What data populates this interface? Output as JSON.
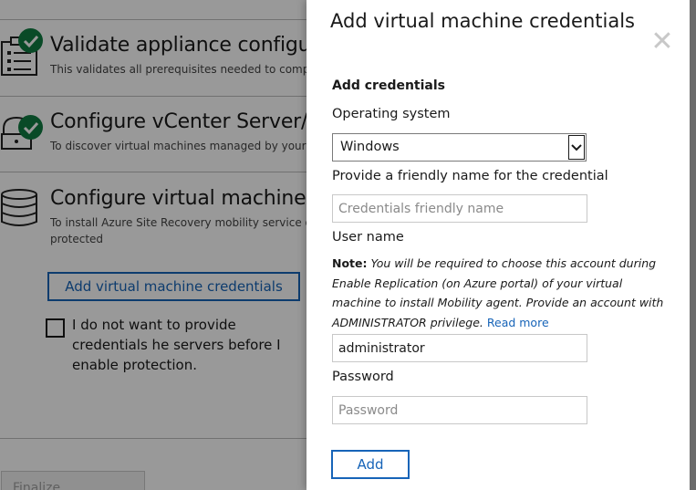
{
  "background": {
    "steps": [
      {
        "title": "Validate appliance configura",
        "description": "This validates all prerequisites needed to complet"
      },
      {
        "title": "Configure vCenter Server/vS",
        "description": "To discover virtual machines managed by your vC"
      },
      {
        "title": "Configure virtual machine cr",
        "description": "To install Azure Site Recovery mobility service on",
        "description_line2": "protected"
      }
    ],
    "add_vm_credentials_button": "Add virtual machine credentials",
    "checkbox_label": "I do not want to provide credentials he servers before I enable protection.",
    "finalize_button": "Finalize configuration"
  },
  "dialog": {
    "title": "Add virtual machine credentials",
    "section_heading": "Add credentials",
    "os_label": "Operating system",
    "os_selected": "Windows",
    "friendly_name_label": "Provide a friendly name for the credential",
    "friendly_name_placeholder": "Credentials friendly name",
    "friendly_name_value": "",
    "username_label": "User name",
    "note_prefix": "Note:",
    "note_text": " You will be required to choose this account during Enable Replication (on Azure portal) of your virtual machine to install Mobility agent. Provide an account with ADMINISTRATOR privilege. ",
    "read_more": "Read more",
    "username_value": "administrator",
    "password_label": "Password",
    "password_placeholder": "Password",
    "password_value": "",
    "add_button": "Add"
  },
  "icons": {
    "close": "close-icon",
    "check": "check-circle-icon",
    "clipboard": "clipboard-list-icon",
    "server_lock": "server-lock-icon",
    "database": "database-icon",
    "dropdown": "chevron-down-icon"
  },
  "colors": {
    "accent": "#1764b8",
    "success": "#107c41",
    "overlay": "rgba(0,0,0,0.40)"
  }
}
